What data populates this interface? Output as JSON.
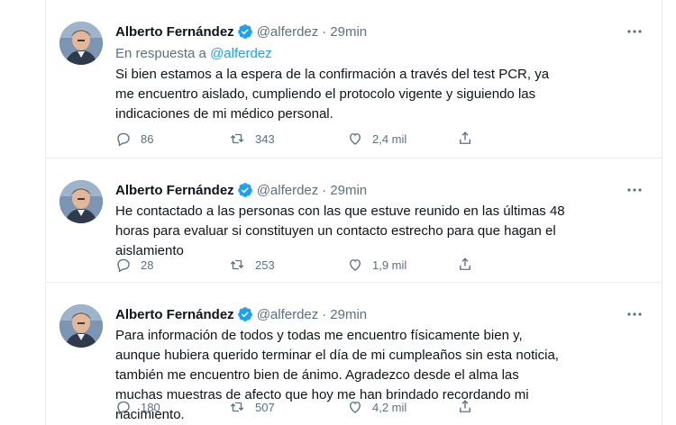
{
  "tweets": [
    {
      "author": {
        "name": "Alberto Fernández",
        "handle": "@alferdez"
      },
      "separator": "·",
      "time": "29min",
      "reply_to": {
        "prefix": "En respuesta a",
        "handle": "@alferdez"
      },
      "text": "Si bien estamos a la espera de la confirmación a través del test PCR, ya me encuentro aislado, cumpliendo el protocolo vigente y siguiendo las indicaciones de mi médico personal.",
      "stats": {
        "replies": "86",
        "retweets": "343",
        "likes": "2,4 mil"
      }
    },
    {
      "author": {
        "name": "Alberto Fernández",
        "handle": "@alferdez"
      },
      "separator": "·",
      "time": "29min",
      "text": "He contactado a las personas con las que estuve reunido en las últimas 48 horas para evaluar si constituyen un contacto estrecho para que hagan el aislamiento",
      "stats": {
        "replies": "28",
        "retweets": "253",
        "likes": "1,9 mil"
      }
    },
    {
      "author": {
        "name": "Alberto Fernández",
        "handle": "@alferdez"
      },
      "separator": "·",
      "time": "29min",
      "text": "Para información de todos y todas me encuentro físicamente bien y, aunque hubiera querido terminar el día de mi cumpleaños sin esta noticia, también me encuentro bien de ánimo. Agradezco desde el alma las muchas muestras de afecto que hoy me han brindado recordando mi nacimiento.",
      "stats": {
        "replies": "180",
        "retweets": "507",
        "likes": "4,2 mil"
      }
    }
  ],
  "icons": {
    "verified": "verified-badge-icon",
    "more": "more-horizontal-icon",
    "reply": "reply-bubble-icon",
    "retweet": "retweet-icon",
    "like": "heart-icon",
    "share": "share-icon"
  },
  "colors": {
    "text": "#0f1419",
    "secondary": "#5b7083",
    "accent": "#1da1f2",
    "divider": "#e6ecf0"
  }
}
